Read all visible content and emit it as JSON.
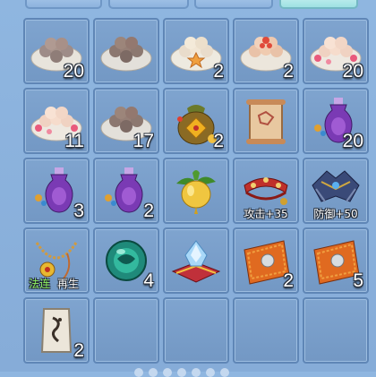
{
  "colors": {
    "accent_tab": "#9fe1e3",
    "slot_bg": "#7a9fca",
    "count_text": "#ffffff",
    "skill_green": "#8df061"
  },
  "slots": [
    {
      "icon": "pink-dumplings-plate-icon",
      "count": "20"
    },
    {
      "icon": "dark-dumplings-plate-icon",
      "count": ""
    },
    {
      "icon": "starfish-dumplings-plate-icon",
      "count": "2"
    },
    {
      "icon": "red-dumplings-plate-icon",
      "count": "2"
    },
    {
      "icon": "rose-dumplings-plate-icon",
      "count": "20"
    },
    {
      "icon": "rose-dumplings-plate-icon",
      "count": "11"
    },
    {
      "icon": "dark-dumplings-plate-icon",
      "count": "17"
    },
    {
      "icon": "lucky-bag-icon",
      "count": "2"
    },
    {
      "icon": "ancient-scroll-icon",
      "count": ""
    },
    {
      "icon": "purple-vase-icon",
      "count": "20"
    },
    {
      "icon": "purple-vase-icon",
      "count": "3"
    },
    {
      "icon": "purple-vase-icon",
      "count": "2"
    },
    {
      "icon": "golden-fruit-icon",
      "count": ""
    },
    {
      "icon": "ruby-collar-icon",
      "count": "",
      "stat": "攻击+35"
    },
    {
      "icon": "armored-pauldron-icon",
      "count": "",
      "stat": "防御+50"
    },
    {
      "icon": "gold-necklace-icon",
      "count": "",
      "skill1": "法连",
      "skill2": "再生"
    },
    {
      "icon": "jade-orb-icon",
      "count": "4"
    },
    {
      "icon": "crystal-cushion-icon",
      "count": ""
    },
    {
      "icon": "orange-pouch-icon",
      "count": "2"
    },
    {
      "icon": "orange-pouch-icon",
      "count": "5"
    },
    {
      "icon": "rune-stone-icon",
      "count": "2"
    },
    {
      "icon": "empty-slot",
      "count": ""
    },
    {
      "icon": "empty-slot",
      "count": ""
    },
    {
      "icon": "empty-slot",
      "count": ""
    },
    {
      "icon": "empty-slot",
      "count": ""
    }
  ]
}
